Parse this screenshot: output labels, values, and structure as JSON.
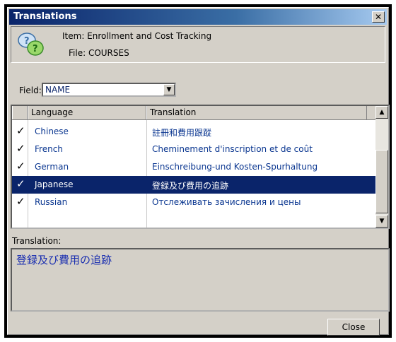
{
  "window": {
    "title": "Translations",
    "close_glyph": "✕"
  },
  "header": {
    "item": "Item: Enrollment and Cost Tracking",
    "file": "File: COURSES",
    "icon": "help-bubbles-icon"
  },
  "field": {
    "label": "Field:",
    "value": "NAME",
    "dropdown_glyph": "▼"
  },
  "grid": {
    "columns": [
      "Language",
      "Translation"
    ],
    "rows": [
      {
        "check": "✓",
        "language": "Chinese",
        "translation": "註冊和費用跟蹤"
      },
      {
        "check": "✓",
        "language": "French",
        "translation": "Cheminement d'inscription et de coût"
      },
      {
        "check": "✓",
        "language": "German",
        "translation": "Einschreibung-und Kosten-Spurhaltung"
      },
      {
        "check": "✓",
        "language": "Japanese",
        "translation": "登録及び費用の追跡",
        "selected": true
      },
      {
        "check": "✓",
        "language": "Russian",
        "translation": "Отслеживать зачисления и цены"
      }
    ],
    "scroll_up": "▲",
    "scroll_down": "▼"
  },
  "translation_panel": {
    "label": "Translation:",
    "value": "登録及び費用の追跡"
  },
  "buttons": {
    "close": "Close"
  },
  "colors": {
    "selection": "#0a246a",
    "link_text": "#0a3690",
    "face": "#d4d0c8"
  }
}
